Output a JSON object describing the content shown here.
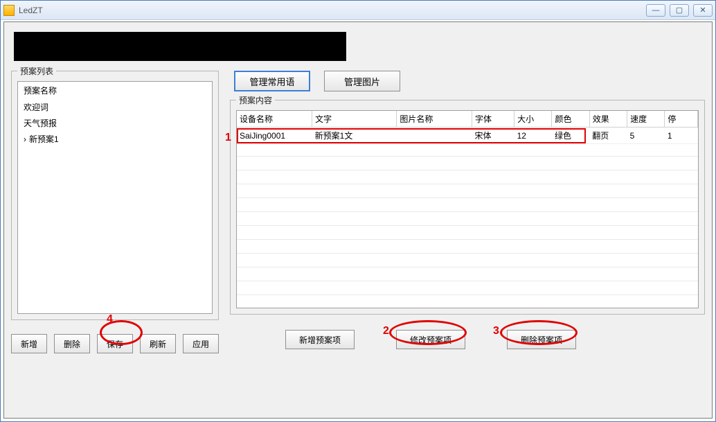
{
  "window": {
    "title": "LedZT"
  },
  "left_panel": {
    "caption": "预案列表",
    "header": "预案名称",
    "items": [
      "欢迎词",
      "天气预报",
      "新预案1"
    ],
    "selected_index": 2
  },
  "left_buttons": {
    "add": "新增",
    "delete": "删除",
    "save": "保存",
    "refresh": "刷新",
    "apply": "应用"
  },
  "top_buttons": {
    "manage_phrases": "管理常用语",
    "manage_images": "管理图片"
  },
  "content_panel": {
    "caption": "预案内容",
    "columns": [
      "设备名称",
      "文字",
      "图片名称",
      "字体",
      "大小",
      "颜色",
      "效果",
      "速度",
      "停"
    ],
    "rows": [
      {
        "device": "SaiJing0001",
        "text": "新预案1文",
        "image": "",
        "font": "宋体",
        "size": "12",
        "color": "绿色",
        "effect": "翻页",
        "speed": "5",
        "stop": "1"
      }
    ]
  },
  "content_buttons": {
    "add_item": "新增预案项",
    "edit_item": "修改预案项",
    "delete_item": "删除预案项"
  },
  "annotations": {
    "n1": "1",
    "n2": "2",
    "n3": "3",
    "n4": "4"
  }
}
